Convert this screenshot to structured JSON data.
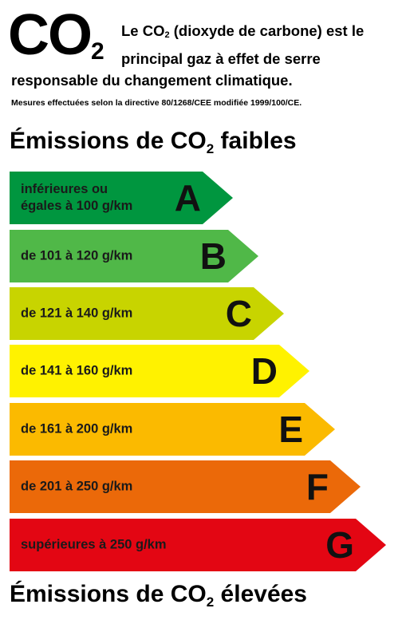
{
  "header": {
    "logo_main": "CO",
    "logo_sub": "2",
    "intro_part1": "Le CO",
    "intro_sub": "2",
    "intro_part2": " (dioxyde de carbone) est le principal gaz à effet de serre",
    "intro_line3": "responsable du changement climatique.",
    "directive": "Mesures effectuées selon la directive 80/1268/CEE modifiée 1999/100/CE."
  },
  "heading_low": {
    "prefix": "Émissions de CO",
    "sub": "2",
    "suffix": " faibles"
  },
  "heading_high": {
    "prefix": "Émissions de CO",
    "sub": "2",
    "suffix": " élevées"
  },
  "bands": [
    {
      "letter": "A",
      "label": "inférieures ou\négales à 100 g/km",
      "color": "#00963f"
    },
    {
      "letter": "B",
      "label": "de 101 à 120 g/km",
      "color": "#50b848"
    },
    {
      "letter": "C",
      "label": "de 121 à 140 g/km",
      "color": "#c8d400"
    },
    {
      "letter": "D",
      "label": "de 141 à 160 g/km",
      "color": "#fff200"
    },
    {
      "letter": "E",
      "label": "de 161 à 200 g/km",
      "color": "#fbba00"
    },
    {
      "letter": "F",
      "label": "de 201 à 250 g/km",
      "color": "#eb6909"
    },
    {
      "letter": "G",
      "label": "supérieures à 250 g/km",
      "color": "#e30613"
    }
  ]
}
